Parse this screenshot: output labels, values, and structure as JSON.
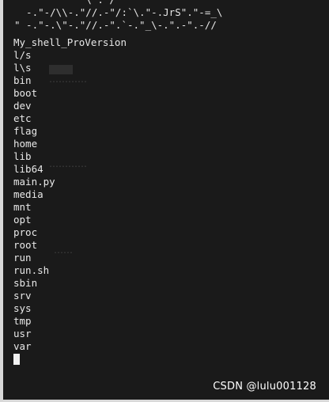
{
  "banner": {
    "line1": "           \"\\ : /\"",
    "line2": "  -.\"-/\\\\-.\"//.-\"/:`\\.\"-.JrS\".\"-=_\\",
    "line3": "\" -.\"-.\\\"-.\"//.-\".`-.\"_\\-.\".-\".-//"
  },
  "terminal": {
    "lines": [
      "My_shell_ProVersion",
      "l/s",
      "l\\s",
      "bin",
      "boot",
      "dev",
      "etc",
      "flag",
      "home",
      "lib",
      "lib64",
      "main.py",
      "media",
      "mnt",
      "opt",
      "proc",
      "root",
      "run",
      "run.sh",
      "sbin",
      "srv",
      "sys",
      "tmp",
      "usr",
      "var"
    ]
  },
  "watermark": "CSDN @lulu001128",
  "colors": {
    "background": "#1a1a1a",
    "text": "#e8e8e8",
    "cursor": "#f2f2f2",
    "frame": "#d8d8d8"
  }
}
